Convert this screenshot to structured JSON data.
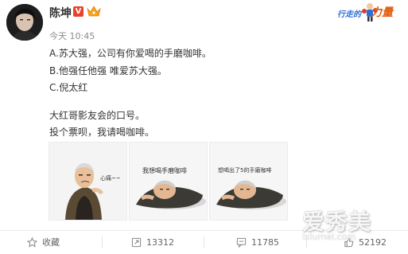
{
  "author": {
    "name": "陈坤",
    "verified_mark": "V",
    "timestamp": "今天 10:45"
  },
  "campaign": {
    "part1": "行走的",
    "part2": "力量"
  },
  "post": {
    "lines": [
      "A.苏大强，公司有你爱喝的手磨咖啡。",
      "B.他强任他强 唯爱苏大强。",
      "C.倪太红",
      "大红哥影友会的口号。",
      "投个票呗，我请喝咖啡。"
    ]
  },
  "images": [
    {
      "caption": "心痛~~"
    },
    {
      "caption": "我想喝手磨咖啡"
    },
    {
      "caption": "想喝出了5的手磨咖啡"
    }
  ],
  "actions": {
    "favorite_label": "收藏",
    "repost_count": "13312",
    "comment_count": "11785",
    "like_count": "52192"
  },
  "watermark": {
    "text": "爱秀美",
    "url": "ixiumei.com"
  },
  "colors": {
    "verified": "#e8412c",
    "campaign_blue": "#2e6fd6",
    "campaign_orange": "#e05d0c"
  }
}
